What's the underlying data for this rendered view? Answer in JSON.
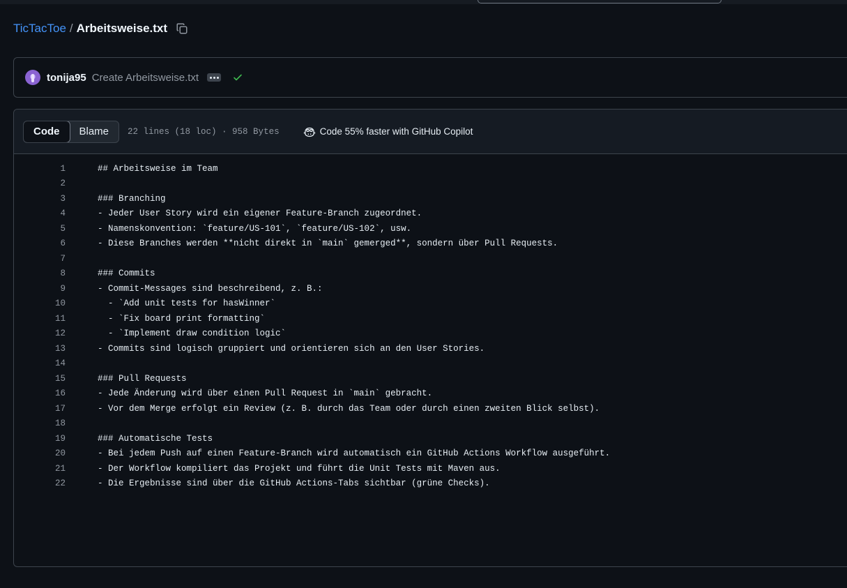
{
  "breadcrumb": {
    "repo": "TicTacToe",
    "separator": "/",
    "file": "Arbeitsweise.txt"
  },
  "commit": {
    "author": "tonija95",
    "message": "Create Arbeitsweise.txt",
    "status_icon": "check-icon",
    "status_color": "#3fb950"
  },
  "file_header": {
    "tab_code": "Code",
    "tab_blame": "Blame",
    "meta": "22 lines (18 loc) · 958 Bytes",
    "copilot": "Code 55% faster with GitHub Copilot"
  },
  "code_lines": [
    {
      "num": "1",
      "text": "## Arbeitsweise im Team"
    },
    {
      "num": "2",
      "text": ""
    },
    {
      "num": "3",
      "text": "### Branching"
    },
    {
      "num": "4",
      "text": "- Jeder User Story wird ein eigener Feature-Branch zugeordnet."
    },
    {
      "num": "5",
      "text": "- Namenskonvention: `feature/US-101`, `feature/US-102`, usw."
    },
    {
      "num": "6",
      "text": "- Diese Branches werden **nicht direkt in `main` gemerged**, sondern über Pull Requests."
    },
    {
      "num": "7",
      "text": ""
    },
    {
      "num": "8",
      "text": "### Commits"
    },
    {
      "num": "9",
      "text": "- Commit-Messages sind beschreibend, z. B.:"
    },
    {
      "num": "10",
      "text": "  - `Add unit tests for hasWinner`"
    },
    {
      "num": "11",
      "text": "  - `Fix board print formatting`"
    },
    {
      "num": "12",
      "text": "  - `Implement draw condition logic`"
    },
    {
      "num": "13",
      "text": "- Commits sind logisch gruppiert und orientieren sich an den User Stories."
    },
    {
      "num": "14",
      "text": ""
    },
    {
      "num": "15",
      "text": "### Pull Requests"
    },
    {
      "num": "16",
      "text": "- Jede Änderung wird über einen Pull Request in `main` gebracht."
    },
    {
      "num": "17",
      "text": "- Vor dem Merge erfolgt ein Review (z. B. durch das Team oder durch einen zweiten Blick selbst)."
    },
    {
      "num": "18",
      "text": ""
    },
    {
      "num": "19",
      "text": "### Automatische Tests"
    },
    {
      "num": "20",
      "text": "- Bei jedem Push auf einen Feature-Branch wird automatisch ein GitHub Actions Workflow ausgeführt."
    },
    {
      "num": "21",
      "text": "- Der Workflow kompiliert das Projekt und führt die Unit Tests mit Maven aus."
    },
    {
      "num": "22",
      "text": "- Die Ergebnisse sind über die GitHub Actions-Tabs sichtbar (grüne Checks)."
    }
  ]
}
